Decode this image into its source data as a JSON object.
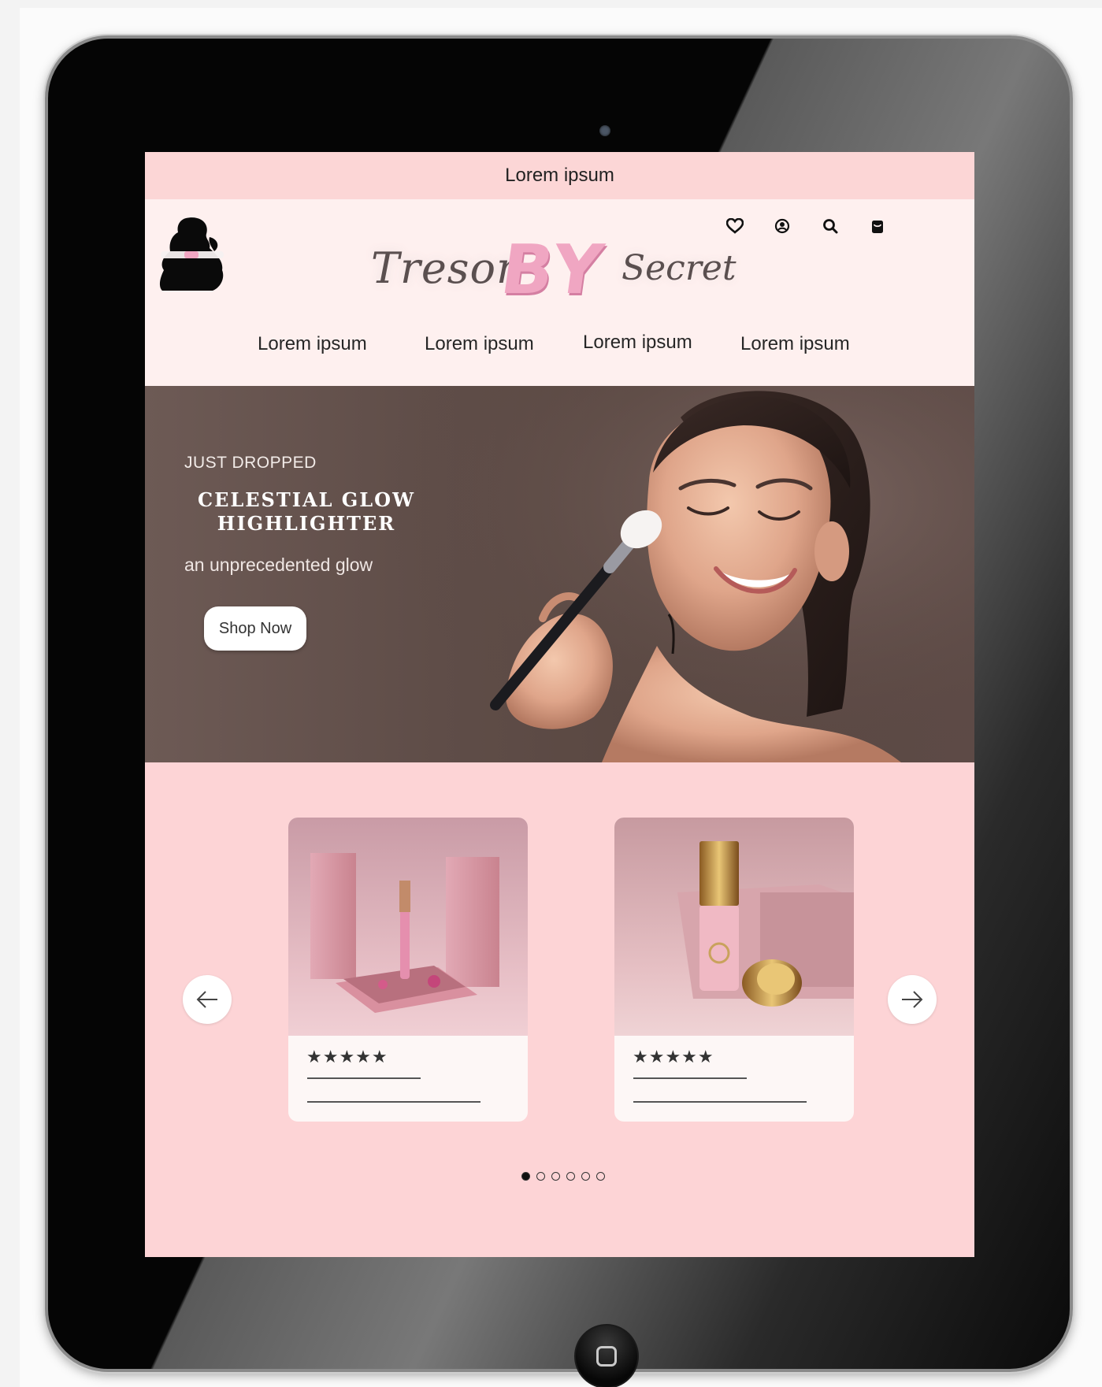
{
  "announcement": {
    "text": "Lorem ipsum"
  },
  "brand": {
    "part1": "Tresor",
    "part2": "BY",
    "part3": "Secret"
  },
  "header_icons": [
    "heart-icon",
    "account-icon",
    "search-icon",
    "bag-icon"
  ],
  "nav": {
    "items": [
      "Lorem ipsum",
      "Lorem ipsum",
      "Lorem ipsum",
      "Lorem ipsum"
    ]
  },
  "hero": {
    "eyebrow": "JUST DROPPED",
    "title": "CELESTIAL GLOW HIGHLIGHTER",
    "subtitle": "an unprecedented glow",
    "cta": "Shop Now"
  },
  "carousel": {
    "prev_icon": "arrow-left-icon",
    "next_icon": "arrow-right-icon",
    "cards": [
      {
        "stars": "★★★★★",
        "rating": 5,
        "image": "pink-lipgloss-gift-box"
      },
      {
        "stars": "★★★★★",
        "rating": 5,
        "image": "pink-gold-foundation-bottle"
      }
    ],
    "pagination": {
      "total": 6,
      "active": 1
    }
  },
  "colors": {
    "announcement_bg": "#fcd6d6",
    "header_bg": "#fef0ef",
    "section_bg": "#fdd4d6",
    "brand_pink": "#f0a6c2",
    "hero_bg": "#5f4d48"
  }
}
